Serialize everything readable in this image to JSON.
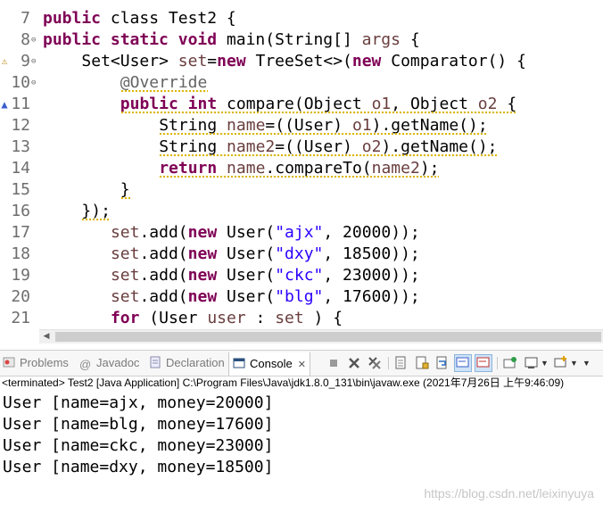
{
  "editor": {
    "lines": [
      {
        "num": "7",
        "indent": 0,
        "fold": "",
        "marker": "",
        "squiggle": false,
        "tokens": [
          [
            "kw",
            "public"
          ],
          [
            "",
            "class Test2 {"
          ]
        ]
      },
      {
        "num": "8",
        "indent": 0,
        "fold": "⊖",
        "marker": "",
        "squiggle": false,
        "tokens": [
          [
            "kw",
            "public"
          ],
          [
            "kw",
            "static"
          ],
          [
            "kw",
            "void"
          ],
          [
            "",
            "main(String[]"
          ],
          [
            "var",
            "args"
          ],
          [
            "",
            " {"
          ]
        ]
      },
      {
        "num": "9",
        "indent": 2,
        "fold": "⊖",
        "marker": "warning",
        "squiggle": false,
        "tokens": [
          [
            "",
            "Set<User>"
          ],
          [
            "var",
            "set"
          ],
          [
            "",
            "="
          ],
          [
            "kw",
            "new"
          ],
          [
            "",
            " TreeSet<>("
          ],
          [
            "kw",
            "new"
          ],
          [
            "",
            " Comparator() {"
          ]
        ]
      },
      {
        "num": "10",
        "indent": 4,
        "fold": "⊖",
        "marker": "",
        "squiggle": true,
        "tokens": [
          [
            "ann",
            "@Override"
          ]
        ]
      },
      {
        "num": "11",
        "indent": 4,
        "fold": "",
        "marker": "override",
        "squiggle": true,
        "tokens": [
          [
            "kw",
            "public"
          ],
          [
            "kw",
            "int"
          ],
          [
            "",
            "compare(Object"
          ],
          [
            "var",
            "o1"
          ],
          [
            "",
            ", Object"
          ],
          [
            "var",
            "o2"
          ],
          [
            "",
            " {"
          ]
        ]
      },
      {
        "num": "12",
        "indent": 6,
        "fold": "",
        "marker": "",
        "squiggle": true,
        "tokens": [
          [
            "",
            "String"
          ],
          [
            "var",
            "name"
          ],
          [
            "",
            "=((User)"
          ],
          [
            "var",
            "o1"
          ],
          [
            "",
            ").getName();"
          ]
        ]
      },
      {
        "num": "13",
        "indent": 6,
        "fold": "",
        "marker": "",
        "squiggle": true,
        "tokens": [
          [
            "",
            "String"
          ],
          [
            "var",
            "name2"
          ],
          [
            "",
            "=((User)"
          ],
          [
            "var",
            "o2"
          ],
          [
            "",
            ").getName();"
          ]
        ]
      },
      {
        "num": "14",
        "indent": 6,
        "fold": "",
        "marker": "",
        "squiggle": true,
        "tokens": [
          [
            "kw",
            "return"
          ],
          [
            "var",
            "name"
          ],
          [
            "",
            ".compareTo("
          ],
          [
            "var",
            "name2"
          ],
          [
            "",
            ");"
          ]
        ]
      },
      {
        "num": "15",
        "indent": 4,
        "fold": "",
        "marker": "",
        "squiggle": true,
        "tokens": [
          [
            "",
            "}"
          ]
        ]
      },
      {
        "num": "16",
        "indent": 2,
        "fold": "",
        "marker": "",
        "squiggle": true,
        "tokens": [
          [
            "",
            "});"
          ]
        ]
      },
      {
        "num": "17",
        "indent": 3.5,
        "fold": "",
        "marker": "",
        "squiggle": false,
        "tokens": [
          [
            "var",
            "set"
          ],
          [
            "",
            ".add("
          ],
          [
            "kw",
            "new"
          ],
          [
            "",
            " User("
          ],
          [
            "str",
            "\"ajx\""
          ],
          [
            "",
            ", 20000));"
          ]
        ]
      },
      {
        "num": "18",
        "indent": 3.5,
        "fold": "",
        "marker": "",
        "squiggle": false,
        "tokens": [
          [
            "var",
            "set"
          ],
          [
            "",
            ".add("
          ],
          [
            "kw",
            "new"
          ],
          [
            "",
            " User("
          ],
          [
            "str",
            "\"dxy\""
          ],
          [
            "",
            ", 18500));"
          ]
        ]
      },
      {
        "num": "19",
        "indent": 3.5,
        "fold": "",
        "marker": "",
        "squiggle": false,
        "tokens": [
          [
            "var",
            "set"
          ],
          [
            "",
            ".add("
          ],
          [
            "kw",
            "new"
          ],
          [
            "",
            " User("
          ],
          [
            "str",
            "\"ckc\""
          ],
          [
            "",
            ", 23000));"
          ]
        ]
      },
      {
        "num": "20",
        "indent": 3.5,
        "fold": "",
        "marker": "",
        "squiggle": false,
        "tokens": [
          [
            "var",
            "set"
          ],
          [
            "",
            ".add("
          ],
          [
            "kw",
            "new"
          ],
          [
            "",
            " User("
          ],
          [
            "str",
            "\"blg\""
          ],
          [
            "",
            ", 17600));"
          ]
        ]
      },
      {
        "num": "21",
        "indent": 3.5,
        "fold": "",
        "marker": "",
        "squiggle": false,
        "tokens": [
          [
            "kw",
            "for"
          ],
          [
            "",
            " (User"
          ],
          [
            "var",
            "user"
          ],
          [
            "",
            " :"
          ],
          [
            "var",
            "set"
          ],
          [
            "",
            " ) {"
          ]
        ]
      }
    ]
  },
  "views": {
    "tabs": [
      {
        "label": "Problems",
        "icon": "problems-icon",
        "active": false
      },
      {
        "label": "Javadoc",
        "icon": "javadoc-icon",
        "active": false
      },
      {
        "label": "Declaration",
        "icon": "declaration-icon",
        "active": false
      },
      {
        "label": "Console",
        "icon": "console-icon",
        "active": true
      }
    ],
    "close_glyph": "✕",
    "toolbar": [
      "terminate-icon",
      "remove-launch-icon",
      "remove-all-terminated-icon",
      "clear-console-icon",
      "scroll-lock-icon",
      "word-wrap-icon",
      "show-on-stdout-icon",
      "show-on-stderr-icon",
      "pin-console-icon",
      "display-selected-console-icon",
      "open-console-icon",
      "view-menu-icon"
    ]
  },
  "console": {
    "description": "<terminated> Test2 [Java Application] C:\\Program Files\\Java\\jdk1.8.0_131\\bin\\javaw.exe (2021年7月26日 上午9:46:09)",
    "output": [
      "User [name=ajx, money=20000]",
      "User [name=blg, money=17600]",
      "User [name=ckc, money=23000]",
      "User [name=dxy, money=18500]"
    ]
  },
  "watermark": "https://blog.csdn.net/leixinyuya",
  "colors": {
    "keyword": "#7f0055",
    "string": "#2a00ff",
    "variable": "#6a3e3e",
    "annotation": "#646464",
    "line_number": "#6e6e6e",
    "warning_squiggle": "#d9b400"
  }
}
